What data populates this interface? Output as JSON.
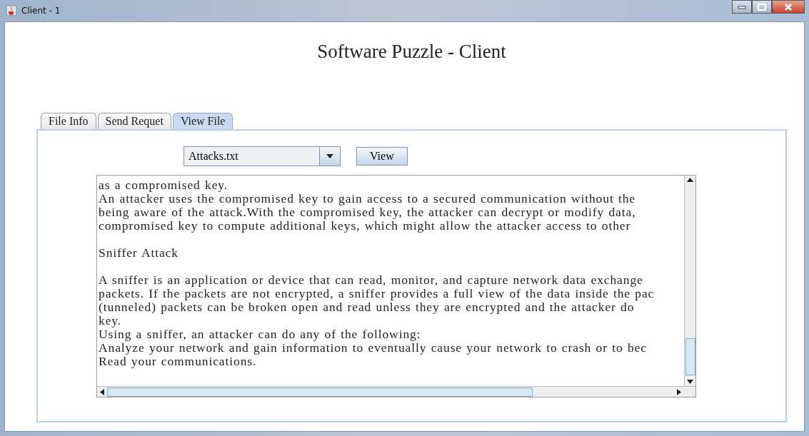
{
  "window": {
    "title": "Client - 1"
  },
  "heading": "Software Puzzle - Client",
  "tabs": [
    {
      "label": "File Info",
      "selected": false
    },
    {
      "label": "Send Requet",
      "selected": false
    },
    {
      "label": "View File",
      "selected": true
    }
  ],
  "file_select": {
    "value": "Attacks.txt"
  },
  "view_button": "View",
  "text_area": {
    "blocks": [
      [
        "as a compromised key.",
        "An attacker uses the compromised key to gain access to a secured communication without the",
        "being aware of the attack.With the compromised key, the attacker can decrypt or modify data,",
        "compromised key to compute additional keys, which might allow the attacker access to other"
      ],
      [
        "Sniffer Attack"
      ],
      [
        "A sniffer is an application or device that can read, monitor, and capture network data exchange",
        "packets. If the packets are not encrypted, a sniffer provides a full view of the data inside the pac",
        " (tunneled) packets can be broken open and read unless they are encrypted and the attacker do",
        "key.",
        "Using a sniffer, an attacker can do any of the following:",
        "Analyze your network and gain information to eventually cause your network to crash or to bec",
        "Read your communications."
      ]
    ]
  }
}
